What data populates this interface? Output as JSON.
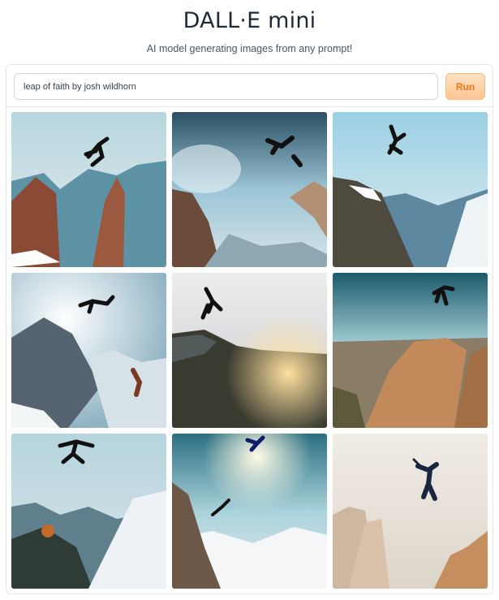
{
  "app": {
    "title": "DALL·E mini",
    "subtitle": "AI model generating images from any prompt!"
  },
  "prompt": {
    "value": "leap of faith by josh wildhorn",
    "placeholder": ""
  },
  "run_button": {
    "label": "Run"
  },
  "results": {
    "count": 9,
    "tiles": [
      {
        "icon": "generated-image"
      },
      {
        "icon": "generated-image"
      },
      {
        "icon": "generated-image"
      },
      {
        "icon": "generated-image"
      },
      {
        "icon": "generated-image"
      },
      {
        "icon": "generated-image"
      },
      {
        "icon": "generated-image"
      },
      {
        "icon": "generated-image"
      },
      {
        "icon": "generated-image"
      }
    ]
  },
  "colors": {
    "run_button_bg": "#fdc590",
    "run_button_text": "#ea7a1b",
    "border": "#e5e7eb"
  }
}
